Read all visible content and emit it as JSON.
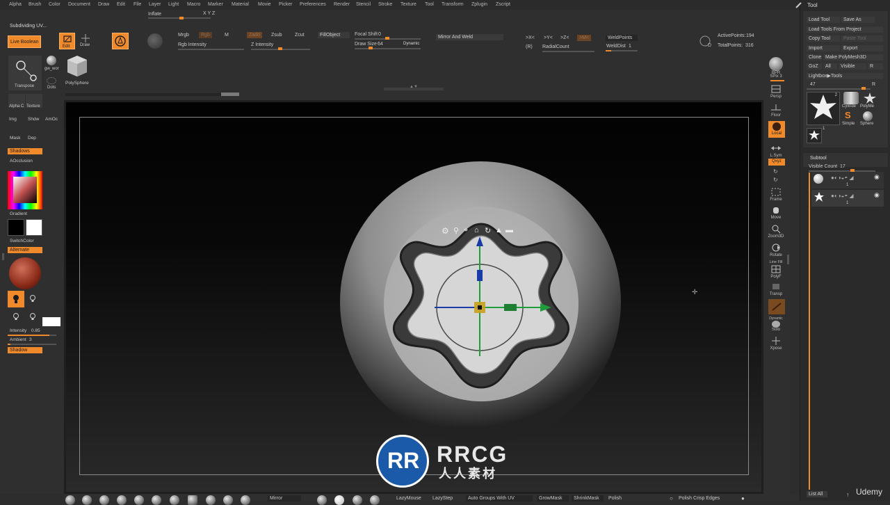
{
  "menu": [
    "Alpha",
    "Brush",
    "Color",
    "Document",
    "Draw",
    "Edit",
    "File",
    "Layer",
    "Light",
    "Macro",
    "Marker",
    "Material",
    "Movie",
    "Picker",
    "Preferences",
    "Render",
    "Stencil",
    "Stroke",
    "Texture",
    "Tool",
    "Transform",
    "Zplugin",
    "Zscript"
  ],
  "top": {
    "inflate_label": "Inflate",
    "xyz_label": "X Y Z",
    "status_text": "Subdividing UV...",
    "live_boolean": "Live Boolean",
    "edit": "Edit",
    "draw": "Draw",
    "mrgb": "Mrgb",
    "rgb": "Rgb",
    "m": "M",
    "zadd": "Zadd",
    "zsub": "Zsub",
    "zcut": "Zcut",
    "rgb_intensity": "Rgb Intensity",
    "z_intensity": "Z Intensity",
    "fill_object": "FillObject",
    "focal_shift_label": "Focal Shift",
    "focal_shift_value": "0",
    "draw_size_label": "Draw Size",
    "draw_size_value": "64",
    "dynamic": "Dynamic",
    "mirror_and_weld": "Mirror And Weld",
    "x_sym": ">X<",
    "y_sym": ">Y<",
    "z_sym": ">Z<",
    "m_sym": ">M<",
    "r_sym": "(R)",
    "radial_count": "RadialCount",
    "weld_points": "WeldPoints",
    "weld_dist_label": "WeldDist",
    "weld_dist_value": "1",
    "active_points_label": "ActivePoints:",
    "active_points_value": "194",
    "total_points_label": "TotalPoints:",
    "total_points_value": "316",
    "transpose": "Transpose",
    "gw_wor": "gw_wor",
    "dots": "Dots",
    "polysphere": "PolySphere"
  },
  "left": {
    "alpha": "Alpha C",
    "texture": "Texture",
    "img": "Img",
    "shdw": "Shdw",
    "amoc": "AmOc",
    "mask": "Mask",
    "dep": "Dep",
    "shadows": "Shadows",
    "aocclusion": "AOcclusion",
    "gradient": "Gradient",
    "switch_color": "SwitchColor",
    "alternate": "Alternate",
    "intensity_label": "Intensity",
    "intensity_value": "0.85",
    "ambient_label": "Ambient",
    "ambient_value": "3",
    "shadow": "Shadow"
  },
  "right_shelf": {
    "bpr": "BPR",
    "spix_label": "SPix",
    "spix_value": "3",
    "persp": "Persp",
    "floor": "Floor",
    "local": "Local",
    "lsym": "L.Sym",
    "qxyz": "Qxyz",
    "frame": "Frame",
    "move": "Move",
    "zoom3d": "Zoom3D",
    "rotate": "Rotate",
    "line_fill": "Line Fill",
    "polyf": "PolyF",
    "transp": "Transp",
    "dynamic": "Dynamic",
    "solo": "Solo",
    "xpose": "Xpose"
  },
  "tool": {
    "title": "Tool",
    "load_tool": "Load Tool",
    "save_as": "Save As",
    "load_from_project": "Load Tools From Project",
    "copy_tool": "Copy Tool",
    "paste_tool": "Paste Tool",
    "import": "Import",
    "export": "Export",
    "clone": "Clone",
    "make_polymesh": "Make PolyMesh3D",
    "goz": "GoZ",
    "all": "All",
    "visible": "Visible",
    "r": "R",
    "lightbox_tools": "Lightbox▶Tools",
    "tool_slider_value": "47",
    "thumb_count": "2",
    "cylinder_label": "Cylinde",
    "polymesh_label": "PolyMe",
    "simple_label": "Simple",
    "sphere_label": "Sphere",
    "one": "1",
    "subtool_title": "Subtool",
    "visible_count_label": "Visible Count",
    "visible_count_value": "17",
    "list_all": "List All",
    "udemy": "Udemy"
  },
  "bottom": {
    "mirror": "Mirror",
    "lazymouse": "LazyMouse",
    "lazystep": "LazyStep",
    "auto_groups": "Auto Groups With UV",
    "growmask": "GrowMask",
    "shrinkmask": "ShrinkMask",
    "polish": "Polish",
    "polish_crisp": "Polish Crisp Edges"
  },
  "watermark": {
    "brand": "RRCG",
    "subtitle": "人人素材"
  },
  "colors": {
    "accent": "#f08a2a",
    "gizmo_x": "#1e9e3a",
    "gizmo_y": "#1a3aa8",
    "gizmo_center": "#c8a020"
  },
  "icons": [
    "gear-icon",
    "pin-icon",
    "location-icon",
    "home-icon",
    "rotate-icon",
    "lock-icon",
    "minus-icon"
  ]
}
